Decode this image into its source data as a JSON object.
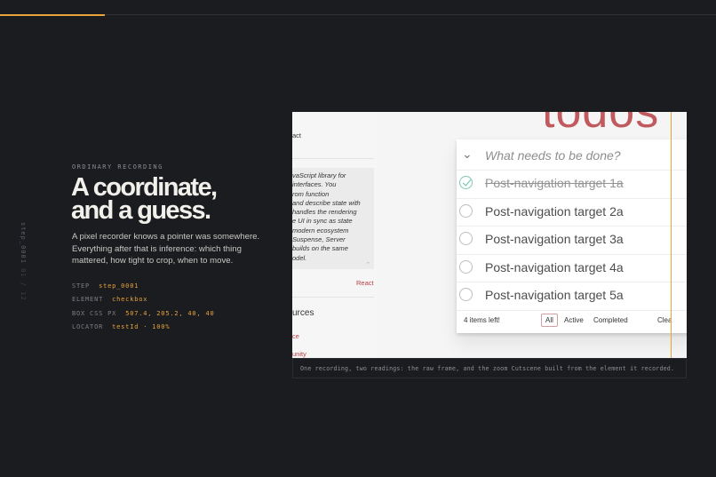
{
  "progress": {
    "fraction": 0.146
  },
  "side_tag": {
    "label": "step_0001",
    "sub": "01 / 12"
  },
  "intro": {
    "eyebrow": "ORDINARY RECORDING",
    "headline_line1": "A coordinate,",
    "headline_line2": "and a guess.",
    "body": "A pixel recorder knows a pointer was somewhere. Everything after that is inference: which thing mattered, how tight to crop, when to move."
  },
  "meta": [
    {
      "key": "STEP",
      "value": "step_0001"
    },
    {
      "key": "ELEMENT",
      "value": "checkbox"
    },
    {
      "key": "BOX CSS PX",
      "value": "507.4, 205.2, 40, 40"
    },
    {
      "key": "LOCATOR",
      "value": "testId · 100%"
    }
  ],
  "screenshot": {
    "left_pane": {
      "react_label": "act",
      "quote": "vaScript library for\ninterfaces. You\nrom function\nand describe state with\nhandles the rendering\ne UI in sync as state\nmodern ecosystem\nSuspense, Server\nbuilds on the same\nodel.",
      "quote_mark": "”",
      "react_link": "React",
      "resources_heading": "urces",
      "link1": "ce",
      "link2": "unity"
    },
    "app_title": "todos",
    "input_placeholder": "What needs to be done?",
    "toggle_all_icon": "chevron-down",
    "todos": [
      {
        "label": "Post-navigation target 1a",
        "completed": true
      },
      {
        "label": "Post-navigation target 2a",
        "completed": false
      },
      {
        "label": "Post-navigation target 3a",
        "completed": false
      },
      {
        "label": "Post-navigation target 4a",
        "completed": false
      },
      {
        "label": "Post-navigation target 5a",
        "completed": false
      }
    ],
    "footer": {
      "count": "4 items left!",
      "filters": [
        "All",
        "Active",
        "Completed"
      ],
      "selected_filter": "All",
      "clear": "Clea"
    }
  },
  "caption": "One recording, two readings: the raw frame, and the zoom Cutscene built from the element it recorded.",
  "colors": {
    "accent": "#e8a33a",
    "todo_red": "#b83f45",
    "background": "#1b1c20"
  }
}
